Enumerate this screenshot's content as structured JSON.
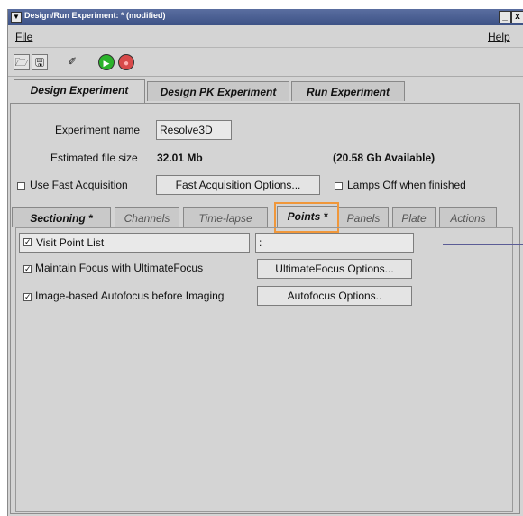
{
  "window": {
    "title": "Design/Run Experiment: * (modified)",
    "minimize": "_",
    "close": "x"
  },
  "menu": {
    "file": "File",
    "help": "Help"
  },
  "toolbar": [
    {
      "name": "open-icon",
      "glyph": "🗁"
    },
    {
      "name": "save-icon",
      "glyph": "🖫"
    },
    {
      "name": "wizard-icon",
      "glyph": "✐"
    },
    {
      "name": "play-icon",
      "glyph": "▶"
    },
    {
      "name": "stop-icon",
      "glyph": "●"
    }
  ],
  "main_tabs": [
    "Design Experiment",
    "Design PK Experiment",
    "Run Experiment"
  ],
  "form": {
    "experiment_name_label": "Experiment name",
    "experiment_name_value": "Resolve3D",
    "estimated_size_label": "Estimated file size",
    "estimated_size_value": "32.01 Mb",
    "available": "(20.58 Gb Available)",
    "fast_acq_label": "Use Fast Acquisition",
    "fast_acq_button": "Fast Acquisition Options...",
    "lamps_off_label": "Lamps Off when finished"
  },
  "sub_tabs": [
    "Sectioning *",
    "Channels",
    "Time-lapse",
    "Points *",
    "Panels",
    "Plate",
    "Actions"
  ],
  "points": {
    "visit_point_list": "Visit Point List",
    "visit_point_field": ":",
    "maintain_focus": "Maintain Focus with UltimateFocus",
    "ultimate_options": "UltimateFocus Options...",
    "autofocus": "Image-based Autofocus before Imaging",
    "autofocus_options": "Autofocus Options.."
  },
  "colors": {
    "highlight": "#f0973a",
    "titlebar": "#3d5286"
  }
}
